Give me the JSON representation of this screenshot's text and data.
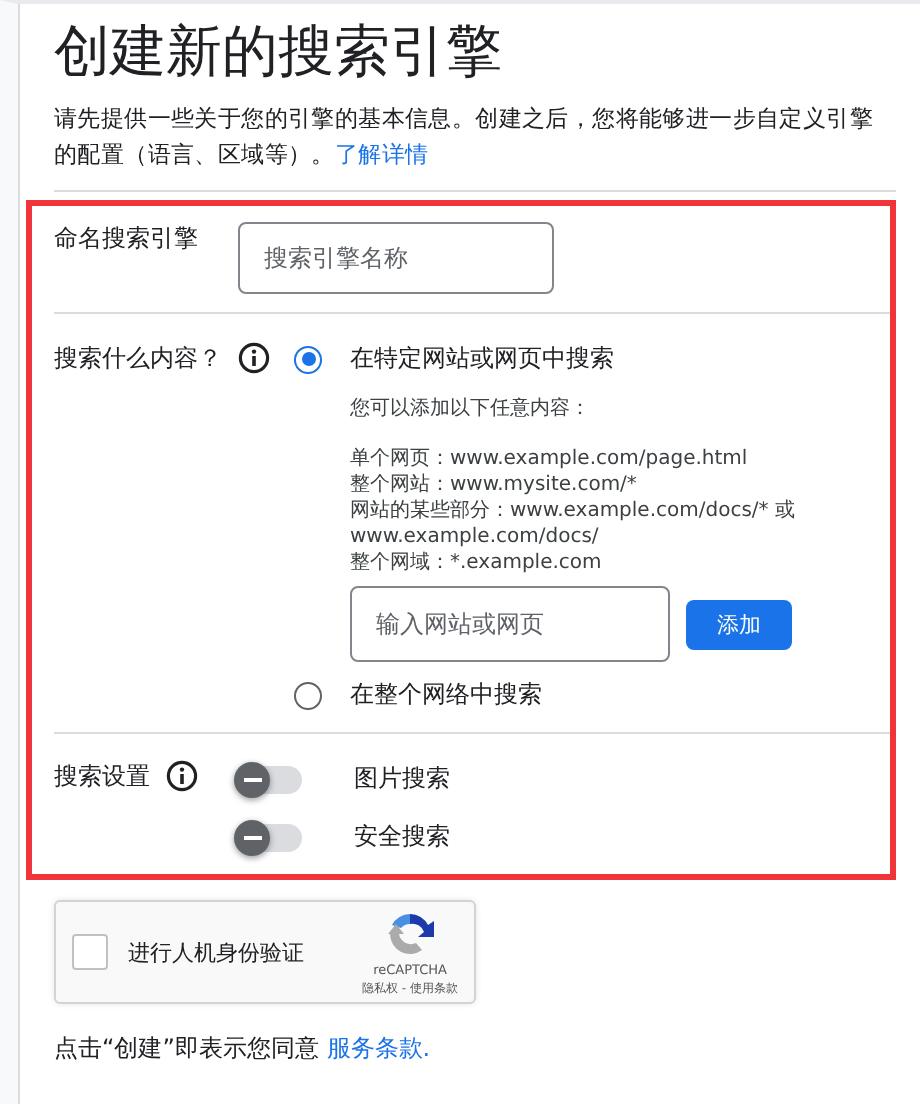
{
  "title": "创建新的搜索引擎",
  "intro": {
    "text": "请先提供一些关于您的引擎的基本信息。创建之后，您将能够进一步自定义引擎的配置（语言、区域等）。",
    "link": "了解详情"
  },
  "name_section": {
    "label": "命名搜索引擎",
    "placeholder": "搜索引擎名称"
  },
  "content_section": {
    "label": "搜索什么内容？",
    "options": [
      {
        "label": "在特定网站或网页中搜索",
        "selected": true
      },
      {
        "label": "在整个网络中搜索",
        "selected": false
      }
    ],
    "hint_lines": [
      "您可以添加以下任意内容：",
      "单个网页：www.example.com/page.html",
      "整个网站：www.mysite.com/*",
      "网站的某些部分：www.example.com/docs/* 或 www.example.com/docs/",
      "整个网域：*.example.com"
    ],
    "site_field": {
      "placeholder": "输入网站或网页"
    },
    "add_button": "添加"
  },
  "settings_section": {
    "label": "搜索设置",
    "toggles": [
      {
        "label": "图片搜索",
        "on": false
      },
      {
        "label": "安全搜索",
        "on": false
      }
    ]
  },
  "captcha": {
    "label": "进行人机身份验证",
    "checked": false,
    "brand": "reCAPTCHA",
    "links": "隐私权 - 使用条款"
  },
  "terms": {
    "text": "点击“创建”即表示您同意",
    "link": "服务条款."
  }
}
